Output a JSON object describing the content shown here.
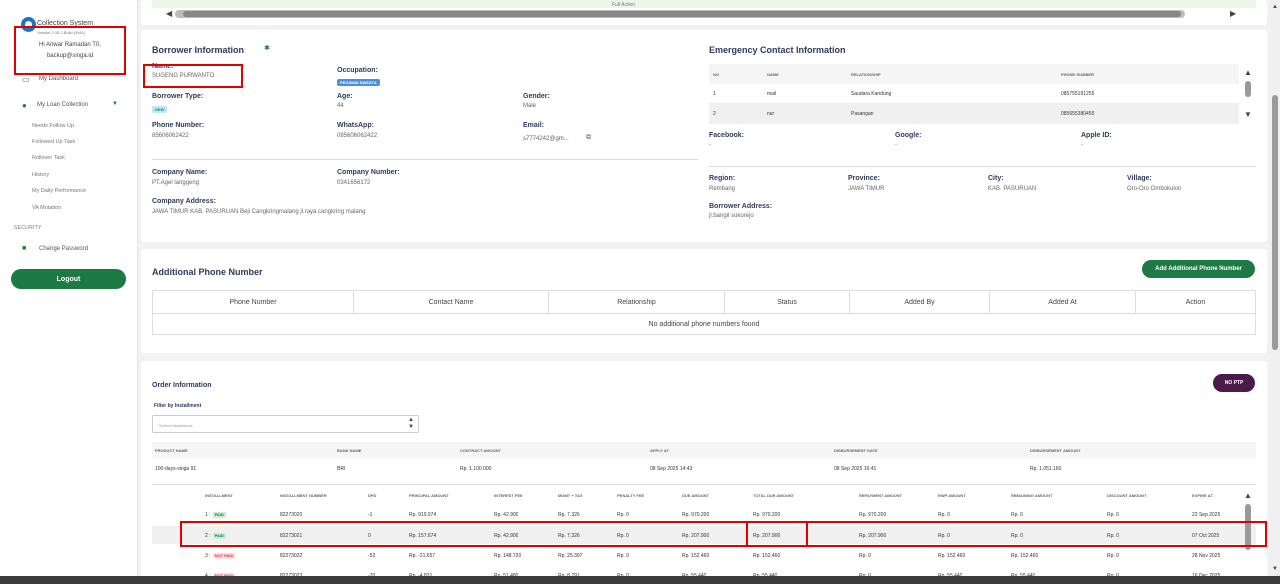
{
  "sidebar": {
    "app_name": "Collection System",
    "version": "Version 2.35.2 Build (3981)",
    "greeting_line1": "Hi Anwar Ramadan T0,",
    "greeting_line2": "backup@singa.id",
    "items": [
      {
        "label": "My Dashboard",
        "icon": "monitor-icon"
      },
      {
        "label": "My Loan Collection",
        "icon": "thumbs-up-icon"
      }
    ],
    "sub_items": [
      "Needs Follow Up",
      "Followed Up Task",
      "Rollover Task",
      "History",
      "My Daily Performance",
      "VA Mutation"
    ],
    "security_label": "SECURITY",
    "change_password": "Change Password",
    "logout": "Logout"
  },
  "top_card": {
    "full_action": "Full Action"
  },
  "borrower": {
    "title": "Borrower Information",
    "name_label": "Name:",
    "name": "SUGENG PURWANTO",
    "occupation_label": "Occupation:",
    "occupation": "PEGAWAI SWASTA",
    "type_label": "Borrower Type:",
    "type": "NEW",
    "age_label": "Age:",
    "age": "44",
    "gender_label": "Gender:",
    "gender": "Male",
    "phone_label": "Phone Number:",
    "phone": "85606062422",
    "whatsapp_label": "WhatsApp:",
    "whatsapp": "085606062422",
    "email_label": "Email:",
    "email": "s7774242@gm...",
    "company_name_label": "Company Name:",
    "company_name": "PT.Agel langgeng",
    "company_number_label": "Company Number:",
    "company_number": "0341656172",
    "company_address_label": "Company Address:",
    "company_address": "JAWA TIMUR KAB. PASURUAN Beji Cangkringmalang jl.raya cangkring malang"
  },
  "emergency": {
    "title": "Emergency Contact Information",
    "headers": [
      "NO",
      "NAME",
      "RELATIONSHIP",
      "PHONE NUMBER"
    ],
    "rows": [
      {
        "no": "1",
        "name": "mail",
        "relationship": "Saudara Kandung",
        "phone": "085755191255"
      },
      {
        "no": "2",
        "name": "nur",
        "relationship": "Pasangan",
        "phone": "085655380455"
      }
    ],
    "facebook_label": "Facebook:",
    "facebook": "-",
    "google_label": "Google:",
    "google": "-",
    "apple_label": "Apple ID:",
    "apple": "-",
    "region_label": "Region:",
    "region": "Rembang",
    "province_label": "Province:",
    "province": "JAWA TIMUR",
    "city_label": "City:",
    "city": "KAB. PASURUAN",
    "village_label": "Village:",
    "village": "Oro-Oro Ombokulon",
    "address_label": "Borrower Address:",
    "address": "jl.bangil sukorejo"
  },
  "additional_phone": {
    "title": "Additional Phone Number",
    "add_button": "Add Additional Phone Number",
    "headers": [
      "Phone Number",
      "Contact Name",
      "Relationship",
      "Status",
      "Added By",
      "Added At",
      "Action"
    ],
    "empty": "No additional phone numbers found"
  },
  "order": {
    "title": "Order Information",
    "ptp_button": "NO PTP",
    "filter_label": "Filter by Installment",
    "filter_placeholder": "Select Installments",
    "headers": [
      "PRODUCT NAME",
      "BANK NAME",
      "CONTRACT AMOUNT",
      "APPLY AT",
      "DISBURSEMENT DATE",
      "DISBURSEMENT AMOUNT"
    ],
    "row": {
      "product": "100-days-singa 91",
      "bank": "BRI",
      "contract": "Rp. 1.100.000",
      "apply": "08 Sep 2025 14:43",
      "disb_date": "08 Sep 2025 16:41",
      "disb_amount": "Rp. 1.051.160"
    }
  },
  "installments": {
    "headers": [
      "INSTALLMENT",
      "INSTALLMENT NUMBER",
      "DPD",
      "PRINCIPAL AMOUNT",
      "INTEREST FEE",
      "MGMT + TAX",
      "PENALTY FEE",
      "DUE AMOUNT",
      "TOTAL DUE AMOUNT",
      "REPAYMENT AMOUNT",
      "RWP AMOUNT",
      "REMAINING AMOUNT",
      "DISCOUNT AMOUNT",
      "EXPIRE AT"
    ],
    "rows": [
      {
        "inst": "1",
        "status": "PAID",
        "number": "82273020",
        "dpd": "-1",
        "principal": "Rp. 919.974",
        "interest": "Rp. 42.900",
        "mgmt": "Rp. 7.326",
        "penalty": "Rp. 0",
        "due": "Rp. 970.200",
        "total_due": "Rp. 970.200",
        "repayment": "Rp. 970.200",
        "rwp": "Rp. 0",
        "remaining": "Rp. 0",
        "discount": "Rp. 0",
        "expire": "22 Sep 2025"
      },
      {
        "inst": "2",
        "status": "PAID",
        "number": "82273021",
        "dpd": "0",
        "principal": "Rp. 157.674",
        "interest": "Rp. 42.900",
        "mgmt": "Rp. 7.326",
        "penalty": "Rp. 0",
        "due": "Rp. 207.900",
        "total_due": "Rp. 207.900",
        "repayment": "Rp. 207.900",
        "rwp": "Rp. 0",
        "remaining": "Rp. 0",
        "discount": "Rp. 0",
        "expire": "07 Oct 2025"
      },
      {
        "inst": "3",
        "status": "NOT PAID",
        "number": "82273022",
        "dpd": "-52",
        "principal": "Rp. -21.657",
        "interest": "Rp. 148.720",
        "mgmt": "Rp. 25.397",
        "penalty": "Rp. 0",
        "due": "Rp. 152.460",
        "total_due": "Rp. 152.460",
        "repayment": "Rp. 0",
        "rwp": "Rp. 152.460",
        "remaining": "Rp. 152.460",
        "discount": "Rp. 0",
        "expire": "28 Nov 2025"
      },
      {
        "inst": "4",
        "status": "NOT PAID",
        "number": "82273023",
        "dpd": "-70",
        "principal": "Rp. -4.831",
        "interest": "Rp. 51.480",
        "mgmt": "Rp. 8.791",
        "penalty": "Rp. 0",
        "due": "Rp. 55.440",
        "total_due": "Rp. 55.440",
        "repayment": "Rp. 0",
        "rwp": "Rp. 55.440",
        "remaining": "Rp. 55.440",
        "discount": "Rp. 0",
        "expire": "16 Dec 2025"
      }
    ]
  }
}
